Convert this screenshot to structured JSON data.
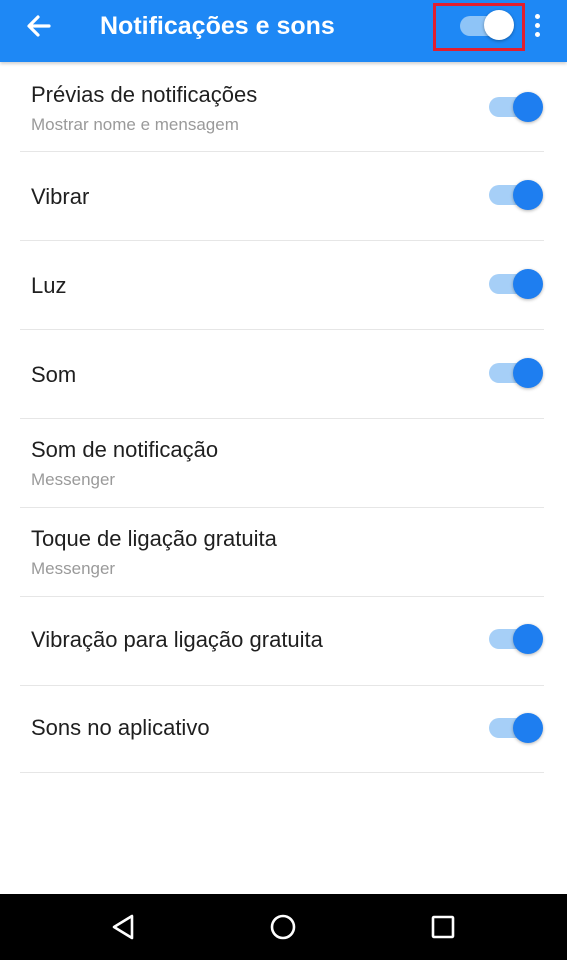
{
  "app_bar": {
    "title": "Notificações e sons",
    "back_icon": "arrow-left-icon",
    "more_icon": "more-vertical-icon",
    "master_toggle": {
      "on": true
    }
  },
  "settings": [
    {
      "label": "Prévias de notificações",
      "sub": "Mostrar nome e mensagem",
      "toggle": true,
      "on": true
    },
    {
      "label": "Vibrar",
      "sub": "",
      "toggle": true,
      "on": true
    },
    {
      "label": "Luz",
      "sub": "",
      "toggle": true,
      "on": true
    },
    {
      "label": "Som",
      "sub": "",
      "toggle": true,
      "on": true
    },
    {
      "label": "Som de notificação",
      "sub": "Messenger",
      "toggle": false
    },
    {
      "label": "Toque de ligação gratuita",
      "sub": "Messenger",
      "toggle": false
    },
    {
      "label": "Vibração para ligação gratuita",
      "sub": "",
      "toggle": true,
      "on": true
    },
    {
      "label": "Sons no aplicativo",
      "sub": "",
      "toggle": true,
      "on": true
    }
  ],
  "nav_bar": {
    "back_icon": "triangle-back-icon",
    "home_icon": "circle-home-icon",
    "recents_icon": "square-recents-icon"
  },
  "colors": {
    "app_bar": "#1e88f5",
    "switch_thumb_on": "#1e7ef0",
    "switch_track_on": "#a6cff7",
    "highlight_box": "#e01e2f"
  }
}
